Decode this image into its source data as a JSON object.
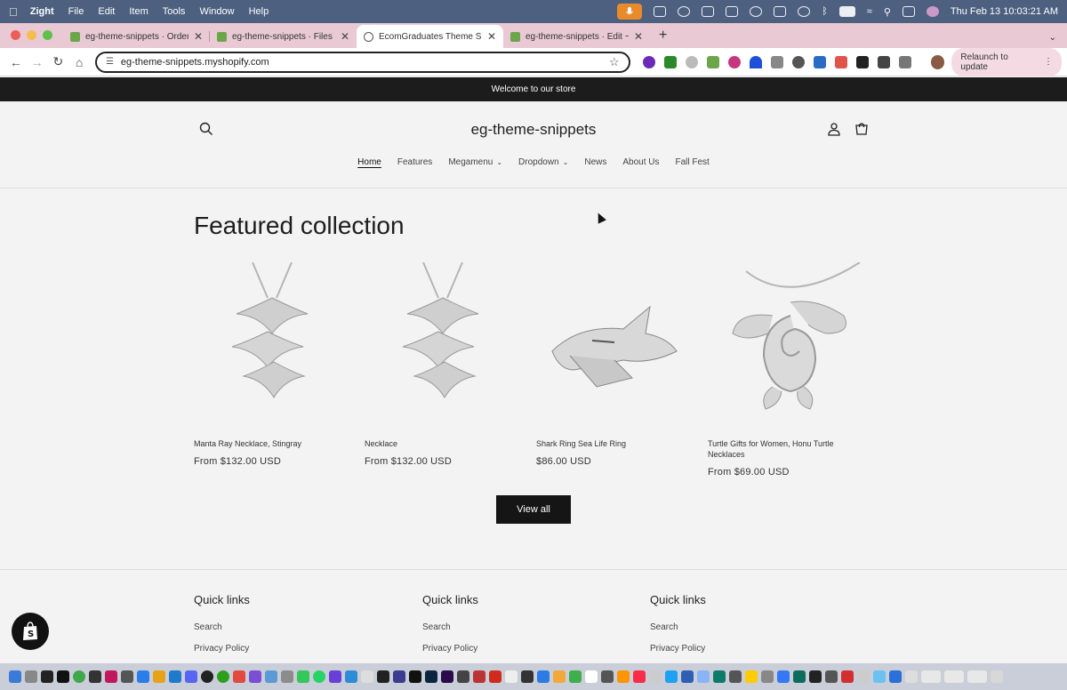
{
  "menubar": {
    "app": "Zight",
    "items": [
      "File",
      "Edit",
      "Item",
      "Tools",
      "Window",
      "Help"
    ],
    "clock": "Thu Feb 13  10:03:21 AM"
  },
  "browser": {
    "tabs": [
      {
        "title": "eg-theme-snippets · Orders",
        "active": false
      },
      {
        "title": "eg-theme-snippets · Files · Sl",
        "active": false
      },
      {
        "title": "EcomGraduates Theme Snipp",
        "active": true
      },
      {
        "title": "eg-theme-snippets · Edit ~ d",
        "active": false
      }
    ],
    "url": "eg-theme-snippets.myshopify.com",
    "relaunch_label": "Relaunch to update"
  },
  "store": {
    "announcement": "Welcome to our store",
    "brand": "eg-theme-snippets",
    "nav": [
      {
        "label": "Home",
        "active": true,
        "dropdown": false
      },
      {
        "label": "Features",
        "active": false,
        "dropdown": false
      },
      {
        "label": "Megamenu",
        "active": false,
        "dropdown": true
      },
      {
        "label": "Dropdown",
        "active": false,
        "dropdown": true
      },
      {
        "label": "News",
        "active": false,
        "dropdown": false
      },
      {
        "label": "About Us",
        "active": false,
        "dropdown": false
      },
      {
        "label": "Fall Fest",
        "active": false,
        "dropdown": false
      }
    ],
    "featured_title": "Featured collection",
    "products": [
      {
        "name": "Manta Ray Necklace, Stingray",
        "price": "From $132.00 USD",
        "image": "manta-ray-necklace"
      },
      {
        "name": "Necklace",
        "price": "From $132.00 USD",
        "image": "manta-ray-necklace"
      },
      {
        "name": "Shark Ring Sea Life Ring",
        "price": "$86.00 USD",
        "image": "shark-ring"
      },
      {
        "name": "Turtle Gifts for Women, Honu Turtle Necklaces",
        "price": "From $69.00 USD",
        "image": "turtle-necklace"
      }
    ],
    "view_all_label": "View all",
    "footer": {
      "columns": [
        {
          "heading": "Quick links",
          "links": [
            "Search",
            "Privacy Policy"
          ]
        },
        {
          "heading": "Quick links",
          "links": [
            "Search",
            "Privacy Policy"
          ]
        },
        {
          "heading": "Quick links",
          "links": [
            "Search",
            "Privacy Policy"
          ]
        }
      ]
    }
  },
  "colors": {
    "menubar_bg": "#4d6080",
    "tabbar_bg": "#e8c9d4",
    "announcement_bg": "#1c1c1c",
    "page_bg": "#f3f3f3",
    "button_bg": "#151515"
  }
}
